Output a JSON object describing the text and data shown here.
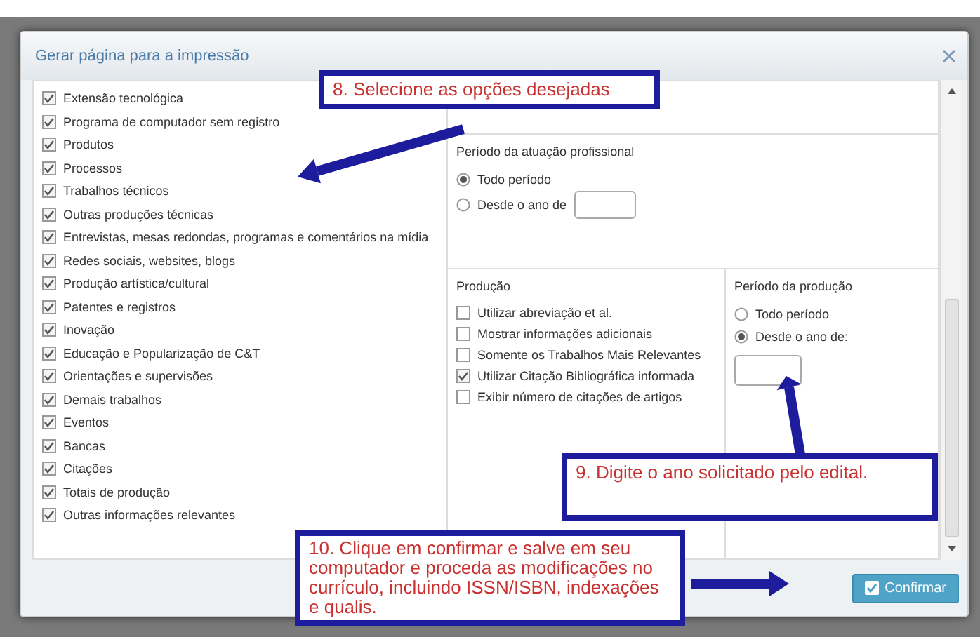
{
  "dialog": {
    "title": "Gerar página para a impressão"
  },
  "sections": [
    {
      "label": "Extensão tecnológica",
      "checked": true
    },
    {
      "label": "Programa de computador sem registro",
      "checked": true
    },
    {
      "label": "Produtos",
      "checked": true
    },
    {
      "label": "Processos",
      "checked": true
    },
    {
      "label": "Trabalhos técnicos",
      "checked": true
    },
    {
      "label": "Outras produções técnicas",
      "checked": true
    },
    {
      "label": "Entrevistas, mesas redondas, programas e comentários na mídia",
      "checked": true
    },
    {
      "label": "Redes sociais, websites, blogs",
      "checked": true
    },
    {
      "label": "Produção artística/cultural",
      "checked": true
    },
    {
      "label": "Patentes e registros",
      "checked": true
    },
    {
      "label": "Inovação",
      "checked": true
    },
    {
      "label": "Educação e Popularização de C&T",
      "checked": true
    },
    {
      "label": "Orientações e supervisões",
      "checked": true
    },
    {
      "label": "Demais trabalhos",
      "checked": true
    },
    {
      "label": "Eventos",
      "checked": true
    },
    {
      "label": "Bancas",
      "checked": true
    },
    {
      "label": "Citações",
      "checked": true
    },
    {
      "label": "Totais de produção",
      "checked": true
    },
    {
      "label": "Outras informações relevantes",
      "checked": true
    }
  ],
  "professional_period": {
    "title": "Período da atuação profissional",
    "options": [
      {
        "label": "Todo período",
        "selected": true,
        "kind": "plain"
      },
      {
        "label": "Desde o ano de",
        "selected": false,
        "kind": "year-inline"
      }
    ]
  },
  "production": {
    "title": "Produção",
    "options": [
      {
        "label": "Utilizar abreviação et al.",
        "checked": false
      },
      {
        "label": "Mostrar informações adicionais",
        "checked": false
      },
      {
        "label": "Somente os Trabalhos Mais Relevantes",
        "checked": false
      },
      {
        "label": "Utilizar Citação Bibliográfica informada",
        "checked": true
      },
      {
        "label": "Exibir número de citações de artigos",
        "checked": false
      }
    ]
  },
  "production_period": {
    "title": "Período da produção",
    "options": [
      {
        "label": "Todo período",
        "selected": false,
        "kind": "plain"
      },
      {
        "label": "Desde o ano de:",
        "selected": true,
        "kind": "year-below"
      }
    ]
  },
  "confirm_button": {
    "label": "Confirmar"
  },
  "annotations": [
    {
      "text": "8. Selecione as opções desejadas",
      "kind": "step8"
    },
    {
      "text": "9. Digite o ano solicitado pelo edital.",
      "kind": "step9"
    },
    {
      "text": "10. Clique em confirmar e salve em seu computador e proceda as modificações no currículo, incluindo ISSN/ISBN, indexações e qualis.",
      "kind": "step10"
    }
  ]
}
